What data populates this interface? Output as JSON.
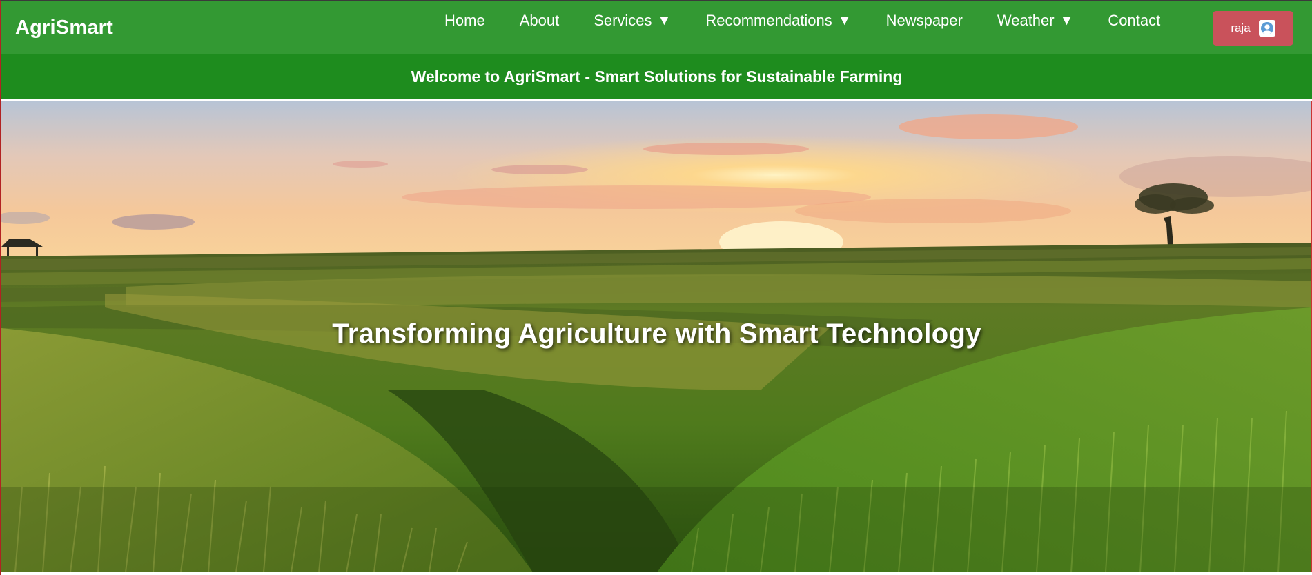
{
  "brand": {
    "name": "AgriSmart"
  },
  "nav": {
    "items": [
      {
        "label": "Home",
        "dropdown": false
      },
      {
        "label": "About",
        "dropdown": false
      },
      {
        "label": "Services",
        "dropdown": true
      },
      {
        "label": "Recommendations",
        "dropdown": true
      },
      {
        "label": "Newspaper",
        "dropdown": false
      },
      {
        "label": "Weather",
        "dropdown": true
      },
      {
        "label": "Contact",
        "dropdown": false
      }
    ],
    "caret": "▼"
  },
  "user": {
    "name": "raja",
    "icon": "user-avatar-icon"
  },
  "banner": {
    "text": "Welcome to AgriSmart - Smart Solutions for Sustainable Farming"
  },
  "hero": {
    "title": "Transforming Agriculture with Smart Technology"
  },
  "colors": {
    "navbar": "#339933",
    "banner": "#1e8c1e",
    "user_button": "#c9525b"
  }
}
